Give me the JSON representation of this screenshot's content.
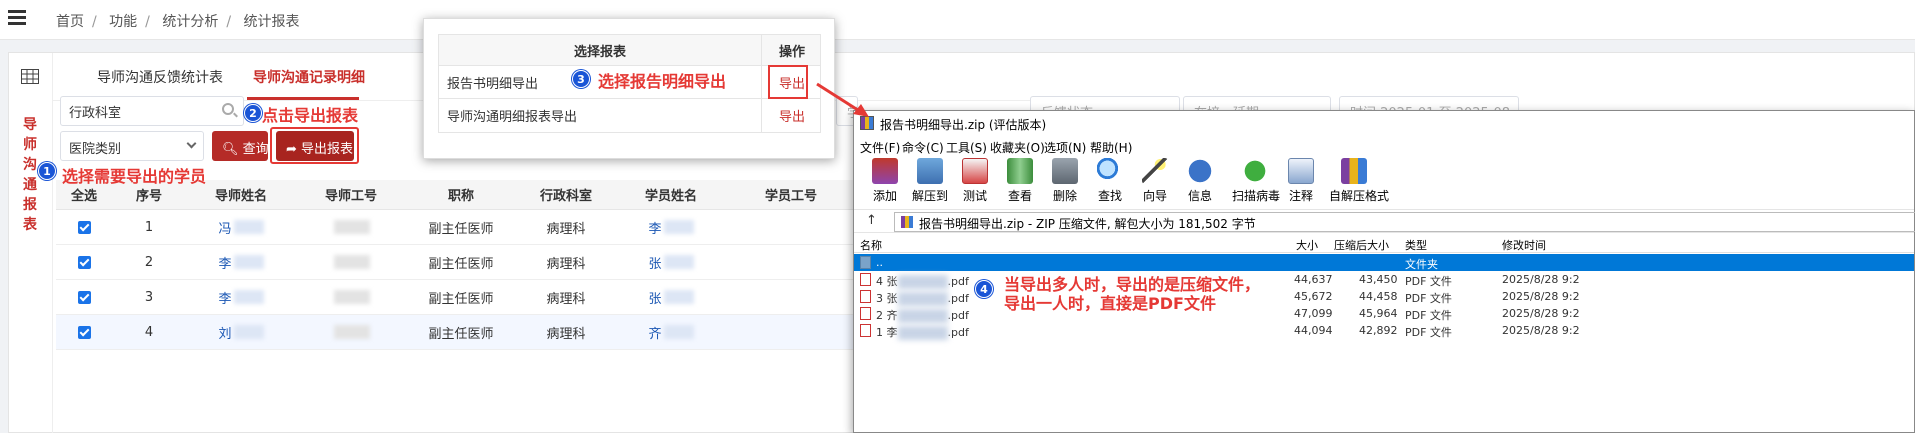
{
  "breadcrumb": [
    "首页",
    "功能",
    "统计分析",
    "统计报表"
  ],
  "sidebar_title": "导师沟通报表",
  "tabs": [
    {
      "label": "导师沟通反馈统计表",
      "active": false
    },
    {
      "label": "导师沟通记录明细",
      "active": true
    }
  ],
  "filters": {
    "dept_value": "行政科室",
    "hospital_value": "医院类别",
    "ghost_fields": [
      "学",
      "反馈状态",
      "在培、延期",
      "时间 2025-01 至 2025-08"
    ]
  },
  "buttons": {
    "query": "查询",
    "export": "导出报表"
  },
  "table": {
    "headers": [
      "全选",
      "序号",
      "导师姓名",
      "导师工号",
      "职称",
      "行政科室",
      "学员姓名",
      "学员工号"
    ],
    "rows": [
      {
        "index": "1",
        "tutor": "冯",
        "title": "副主任医师",
        "dept": "病理科",
        "student": "李",
        "checked": true
      },
      {
        "index": "2",
        "tutor": "李",
        "title": "副主任医师",
        "dept": "病理科",
        "student": "张",
        "checked": true
      },
      {
        "index": "3",
        "tutor": "李",
        "title": "副主任医师",
        "dept": "病理科",
        "student": "张",
        "checked": true
      },
      {
        "index": "4",
        "tutor": "刘",
        "title": "副主任医师",
        "dept": "病理科",
        "student": "齐",
        "checked": true
      }
    ]
  },
  "popup": {
    "headers": [
      "选择报表",
      "操作"
    ],
    "rows": [
      {
        "name": "报告书明细导出",
        "action": "导出"
      },
      {
        "name": "导师沟通明细报表导出",
        "action": "导出"
      }
    ]
  },
  "zip_window": {
    "title": "报告书明细导出.zip (评估版本)",
    "menu": [
      "文件(F)",
      "命令(C)",
      "工具(S)",
      "收藏夹(O)",
      "选项(N)",
      "帮助(H)"
    ],
    "toolbar": [
      "添加",
      "解压到",
      "测试",
      "查看",
      "删除",
      "查找",
      "向导",
      "信息",
      "扫描病毒",
      "注释",
      "自解压格式"
    ],
    "address": "报告书明细导出.zip - ZIP 压缩文件, 解包大小为 181,502 字节",
    "columns": [
      "名称",
      "大小",
      "压缩后大小",
      "类型",
      "修改时间"
    ],
    "rows": [
      {
        "name": "..",
        "size": "",
        "packed": "",
        "type": "文件夹",
        "modified": ""
      },
      {
        "name_prefix": "4 张",
        "name_suffix": ".pdf",
        "size": "44,637",
        "packed": "43,450",
        "type": "PDF 文件",
        "modified": "2025/8/28 9:2"
      },
      {
        "name_prefix": "3 张",
        "name_suffix": ".pdf",
        "size": "45,672",
        "packed": "44,458",
        "type": "PDF 文件",
        "modified": "2025/8/28 9:2"
      },
      {
        "name_prefix": "2 齐",
        "name_suffix": ".pdf",
        "size": "47,099",
        "packed": "45,964",
        "type": "PDF 文件",
        "modified": "2025/8/28 9:2"
      },
      {
        "name_prefix": "1 李",
        "name_suffix": ".pdf",
        "size": "44,094",
        "packed": "42,892",
        "type": "PDF 文件",
        "modified": "2025/8/28 9:2"
      }
    ]
  },
  "annotations": [
    {
      "num": "1",
      "text": "选择需要导出的学员"
    },
    {
      "num": "2",
      "text": "点击导出报表"
    },
    {
      "num": "3",
      "text": "选择报告明细导出"
    },
    {
      "num": "4",
      "text": "当导出多人时，导出的是压缩文件，\n导出一人时，直接是PDF文件"
    }
  ],
  "colors": {
    "accent": "#b52b27",
    "annotation": "#e53935",
    "badge": "#1a55d6",
    "selection": "#0078d7"
  }
}
